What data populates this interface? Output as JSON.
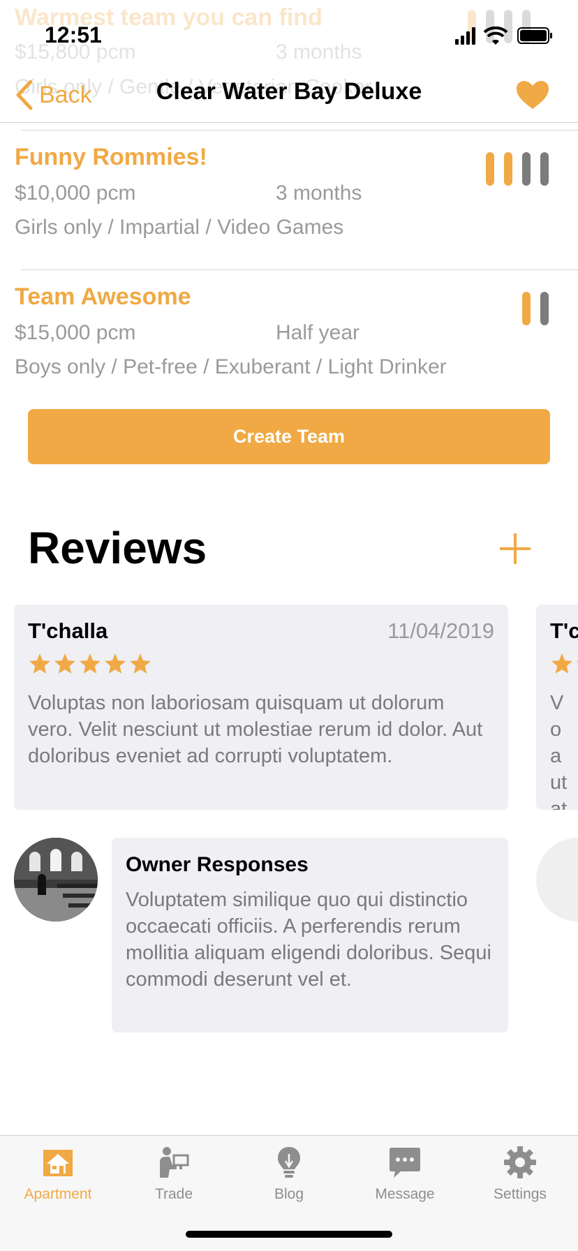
{
  "status_bar": {
    "time": "12:51"
  },
  "nav": {
    "back_label": "Back",
    "title": "Clear Water Bay Deluxe"
  },
  "teams_faded": {
    "name": "Warmest team you can find",
    "price": "$15,800 pcm",
    "duration": "3 months",
    "tags": "Girls only / Gentle / Vegetarian Cooker"
  },
  "teams": [
    {
      "name": "Funny Rommies!",
      "price": "$10,000 pcm",
      "duration": "3 months",
      "tags": "Girls only / Impartial / Video Games",
      "filled_slots": 2,
      "total_slots": 4
    },
    {
      "name": "Team Awesome",
      "price": "$15,000 pcm",
      "duration": "Half year",
      "tags": "Boys only / Pet-free / Exuberant / Light Drinker",
      "filled_slots": 1,
      "total_slots": 2
    }
  ],
  "create_team_label": "Create Team",
  "reviews": {
    "title": "Reviews",
    "items": [
      {
        "reviewer": "T'challa",
        "date": "11/04/2019",
        "rating": 5,
        "text": "Voluptas non laboriosam quisquam ut dolorum vero. Velit nesciunt ut molestiae rerum id dolor. Aut doloribus eveniet ad corrupti voluptatem."
      },
      {
        "reviewer": "T'c",
        "text": "Vo aut atc vol"
      }
    ],
    "owner_response": {
      "title": "Owner Responses",
      "text": "Voluptatem similique quo qui distinctio occaecati officiis. A perferendis rerum mollitia aliquam eligendi doloribus. Sequi commodi deserunt vel et."
    }
  },
  "tabs": [
    {
      "label": "Apartment",
      "icon": "apartment-icon",
      "active": true
    },
    {
      "label": "Trade",
      "icon": "trade-icon",
      "active": false
    },
    {
      "label": "Blog",
      "icon": "lightbulb-icon",
      "active": false
    },
    {
      "label": "Message",
      "icon": "message-icon",
      "active": false
    },
    {
      "label": "Settings",
      "icon": "gear-icon",
      "active": false
    }
  ],
  "colors": {
    "accent": "#f0a944",
    "muted_text": "#9a9a9a",
    "card_bg": "#efeff4",
    "slot_empty": "#7c7c7c"
  }
}
